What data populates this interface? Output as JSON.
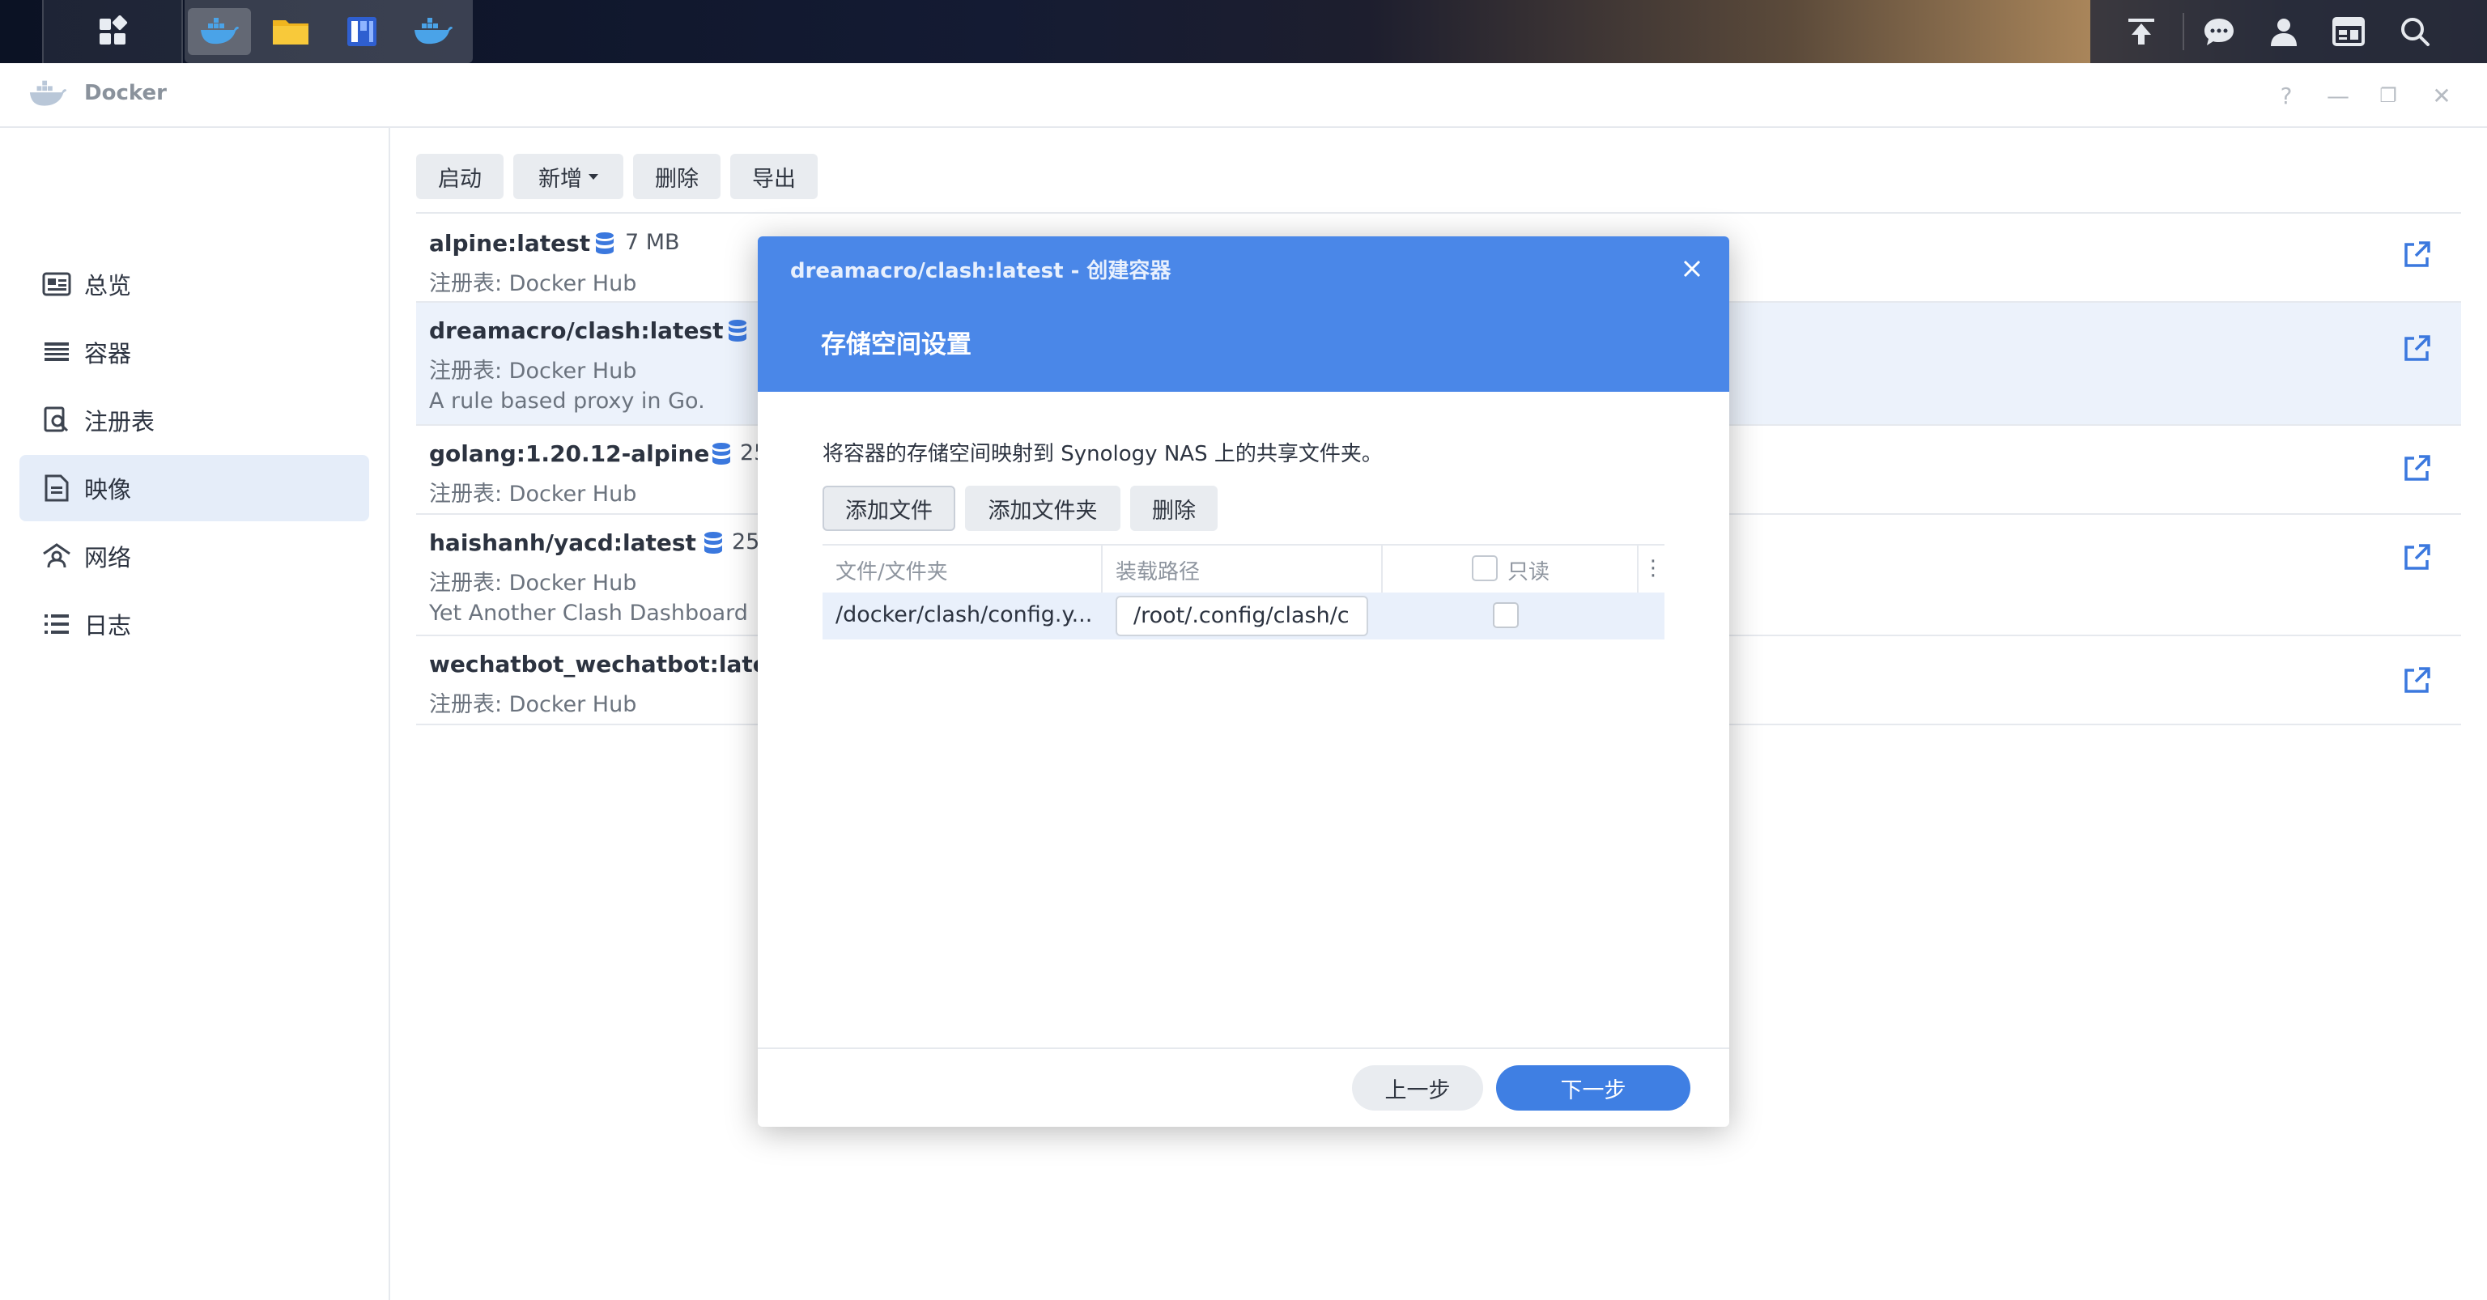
{
  "taskbar": {
    "main_menu_icon": "grid-menu-icon",
    "apps": [
      {
        "name": "docker-app",
        "icon": "docker-whale-icon",
        "active": true
      },
      {
        "name": "file-station-app",
        "icon": "folder-icon",
        "active": false
      },
      {
        "name": "package-center-app",
        "icon": "package-icon",
        "active": false
      },
      {
        "name": "docker-app-2",
        "icon": "docker-whale-icon",
        "active": false
      }
    ],
    "right_icons": [
      "upload-icon",
      "chat-icon",
      "user-icon",
      "widgets-icon",
      "search-icon"
    ]
  },
  "window": {
    "title": "Docker",
    "controls": [
      "?",
      "—",
      "❐",
      "✕"
    ]
  },
  "sidebar": {
    "items": [
      {
        "label": "总览",
        "icon": "overview-icon",
        "active": false
      },
      {
        "label": "容器",
        "icon": "container-icon",
        "active": false
      },
      {
        "label": "注册表",
        "icon": "registry-icon",
        "active": false
      },
      {
        "label": "映像",
        "icon": "image-icon",
        "active": true
      },
      {
        "label": "网络",
        "icon": "network-icon",
        "active": false
      },
      {
        "label": "日志",
        "icon": "log-icon",
        "active": false
      }
    ]
  },
  "toolbar": {
    "start": "启动",
    "add": "新增",
    "delete": "删除",
    "export": "导出"
  },
  "images": [
    {
      "name": "alpine:latest",
      "size": "7 MB",
      "registry": "注册表: Docker Hub",
      "desc": ""
    },
    {
      "name": "dreamacro/clash:latest",
      "size": "",
      "registry": "注册表: Docker Hub",
      "desc": "A rule based proxy in Go."
    },
    {
      "name": "golang:1.20.12-alpine",
      "size": "25",
      "registry": "注册表: Docker Hub",
      "desc": ""
    },
    {
      "name": "haishanh/yacd:latest",
      "size": "25",
      "registry": "注册表: Docker Hub",
      "desc": "Yet Another Clash Dashboard"
    },
    {
      "name": "wechatbot_wechatbot:lates",
      "size": "",
      "registry": "注册表: Docker Hub",
      "desc": ""
    }
  ],
  "dialog": {
    "title": "dreamacro/clash:latest - 创建容器",
    "step": "存储空间设置",
    "description": "将容器的存储空间映射到 Synology NAS 上的共享文件夹。",
    "buttons": {
      "add_file": "添加文件",
      "add_folder": "添加文件夹",
      "delete": "删除"
    },
    "columns": {
      "file_folder": "文件/文件夹",
      "mount_path": "装载路径",
      "readonly": "只读"
    },
    "rows": [
      {
        "file": "/docker/clash/config.y...",
        "mount_path": "/root/.config/clash/c",
        "readonly": false
      }
    ],
    "footer": {
      "prev": "上一步",
      "next": "下一步"
    }
  },
  "colors": {
    "accent": "#4a87e8",
    "primary_button": "#3f7fe3",
    "selected_row": "#ecf2fb",
    "nav_active": "#e5edf9"
  }
}
